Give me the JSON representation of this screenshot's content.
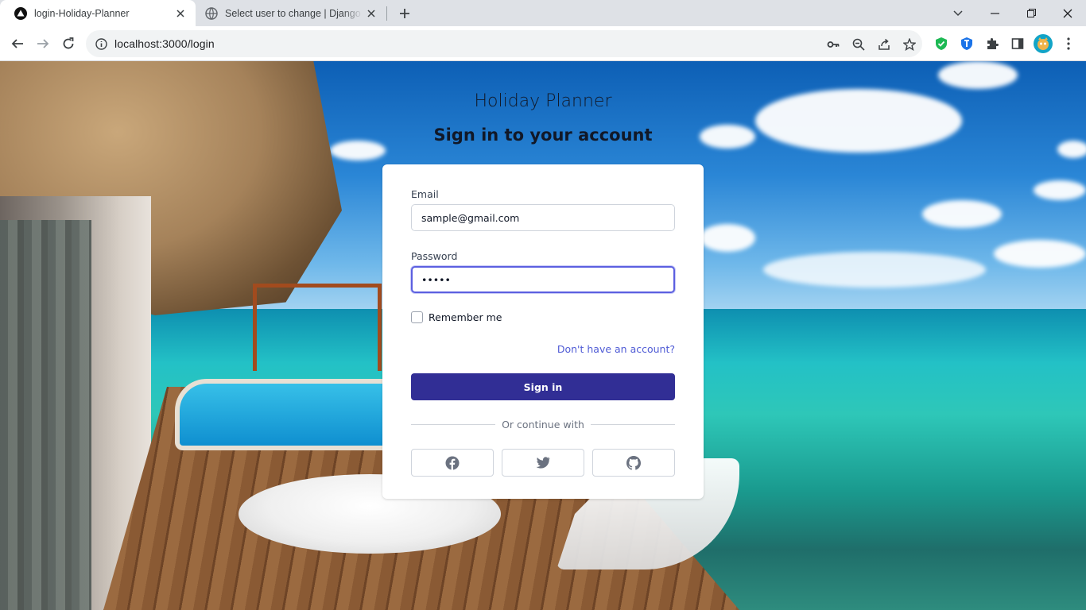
{
  "browser": {
    "tabs": [
      {
        "title": "login-Holiday-Planner",
        "active": true
      },
      {
        "title": "Select user to change | Django site admin",
        "active": false
      }
    ],
    "url": "localhost:3000/login"
  },
  "page": {
    "app_title": "Holiday Planner",
    "heading": "Sign in to your account",
    "form": {
      "email_label": "Email",
      "email_value": "sample@gmail.com",
      "password_label": "Password",
      "password_value": "•••••",
      "remember_label": "Remember me",
      "remember_checked": false,
      "signup_link": "Don't have an account?",
      "signin_button": "Sign in",
      "divider_text": "Or continue with",
      "social_buttons": [
        "facebook-icon",
        "twitter-icon",
        "github-icon"
      ]
    },
    "colors": {
      "primary_button": "#312e95",
      "link": "#4f5bd5",
      "focus_ring": "#5b5fe0"
    }
  }
}
